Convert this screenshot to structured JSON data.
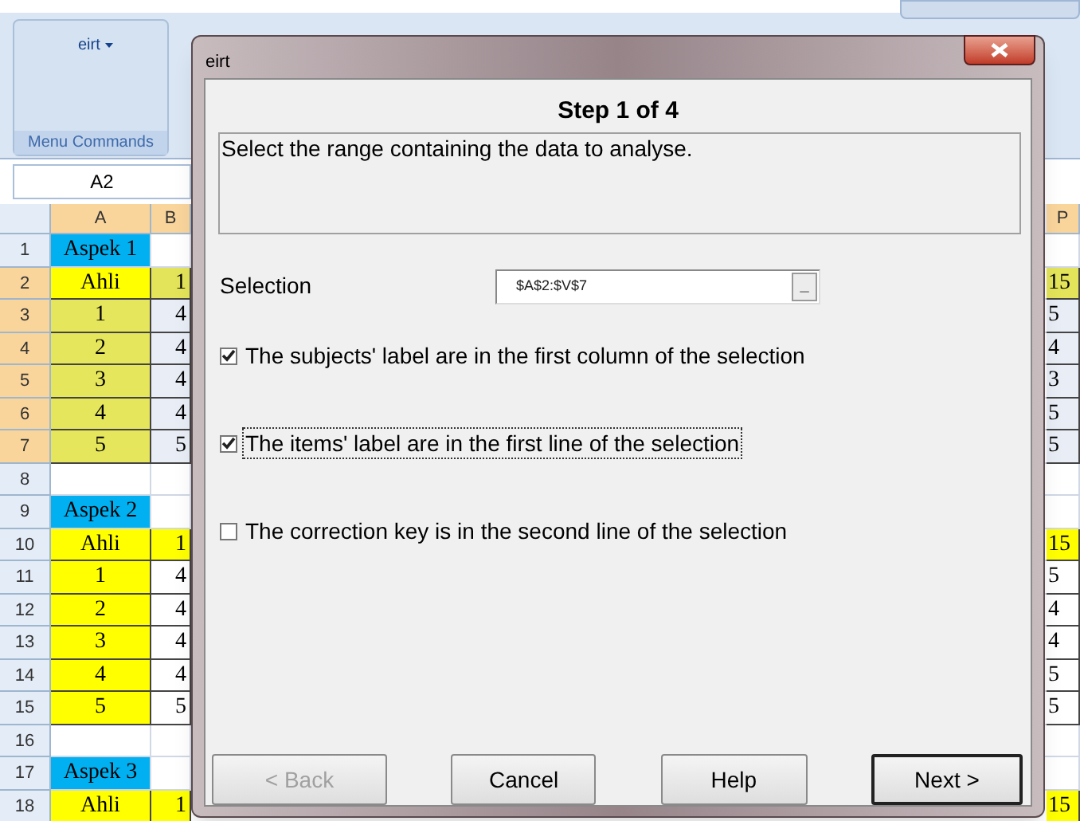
{
  "ribbon": {
    "menu_button": "eirt",
    "group_label": "Menu Commands"
  },
  "name_box": "A2",
  "columns": [
    {
      "label": "A",
      "selected": true
    },
    {
      "label": "B",
      "selected": true
    },
    {
      "label": "P",
      "selected": true
    }
  ],
  "rows": [
    {
      "number": "1",
      "kind": "aspect",
      "selected": false,
      "a": "Aspek 1"
    },
    {
      "number": "2",
      "kind": "header",
      "selected": true,
      "a": "Ahli",
      "b": "1",
      "p": "15"
    },
    {
      "number": "3",
      "kind": "item",
      "selected": true,
      "a": "1",
      "b": "4",
      "p": "5"
    },
    {
      "number": "4",
      "kind": "item",
      "selected": true,
      "a": "2",
      "b": "4",
      "p": "4"
    },
    {
      "number": "5",
      "kind": "item",
      "selected": true,
      "a": "3",
      "b": "4",
      "p": "3"
    },
    {
      "number": "6",
      "kind": "item",
      "selected": true,
      "a": "4",
      "b": "4",
      "p": "5"
    },
    {
      "number": "7",
      "kind": "item",
      "selected": true,
      "a": "5",
      "b": "5",
      "p": "5"
    },
    {
      "number": "8",
      "kind": "blank",
      "selected": false
    },
    {
      "number": "9",
      "kind": "aspect",
      "selected": false,
      "a": "Aspek 2"
    },
    {
      "number": "10",
      "kind": "header",
      "selected": false,
      "a": "Ahli",
      "b": "1",
      "p": "15"
    },
    {
      "number": "11",
      "kind": "item",
      "selected": false,
      "a": "1",
      "b": "4",
      "p": "5"
    },
    {
      "number": "12",
      "kind": "item",
      "selected": false,
      "a": "2",
      "b": "4",
      "p": "4"
    },
    {
      "number": "13",
      "kind": "item",
      "selected": false,
      "a": "3",
      "b": "4",
      "p": "4"
    },
    {
      "number": "14",
      "kind": "item",
      "selected": false,
      "a": "4",
      "b": "4",
      "p": "5"
    },
    {
      "number": "15",
      "kind": "item",
      "selected": false,
      "a": "5",
      "b": "5",
      "p": "5"
    },
    {
      "number": "16",
      "kind": "blank",
      "selected": false
    },
    {
      "number": "17",
      "kind": "aspect",
      "selected": false,
      "a": "Aspek 3"
    },
    {
      "number": "18",
      "kind": "header",
      "selected": false,
      "a": "Ahli",
      "b": "1",
      "p": "15"
    }
  ],
  "dialog": {
    "title": "eirt",
    "step": "Step 1 of 4",
    "instruction": "Select the range containing the data to analyse.",
    "selection_label": "Selection",
    "selection_value": "$A$2:$V$7",
    "picker_button": "_",
    "options": [
      {
        "label": "The subjects' label are in the first column of the selection",
        "checked": true,
        "focused": false
      },
      {
        "label": "The items' label are in the first line of the selection",
        "checked": true,
        "focused": true
      },
      {
        "label": "The correction key is in the second line of the selection",
        "checked": false,
        "focused": false
      }
    ],
    "buttons": [
      {
        "label": "< Back",
        "disabled": true,
        "default": false
      },
      {
        "label": "Cancel",
        "disabled": false,
        "default": false
      },
      {
        "label": "Help",
        "disabled": false,
        "default": false
      },
      {
        "label": "Next >",
        "disabled": false,
        "default": true
      }
    ]
  }
}
